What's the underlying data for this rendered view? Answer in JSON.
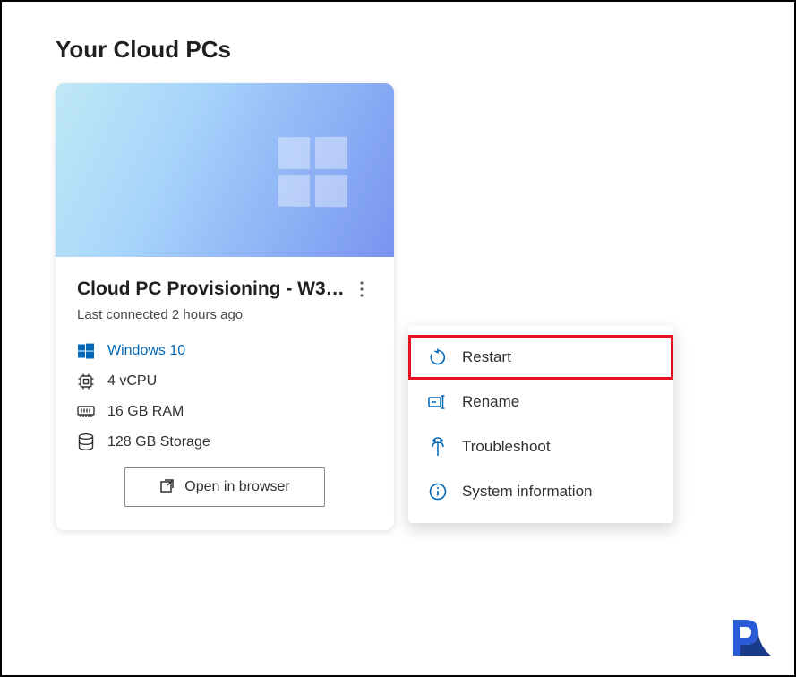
{
  "page": {
    "title": "Your Cloud PCs"
  },
  "card": {
    "title": "Cloud PC Provisioning - W3…",
    "subtitle": "Last connected 2 hours ago",
    "os_label": "Windows 10",
    "cpu_label": "4 vCPU",
    "ram_label": "16 GB RAM",
    "storage_label": "128 GB Storage",
    "open_button": "Open in browser"
  },
  "menu": {
    "restart": "Restart",
    "rename": "Rename",
    "troubleshoot": "Troubleshoot",
    "sysinfo": "System information"
  }
}
